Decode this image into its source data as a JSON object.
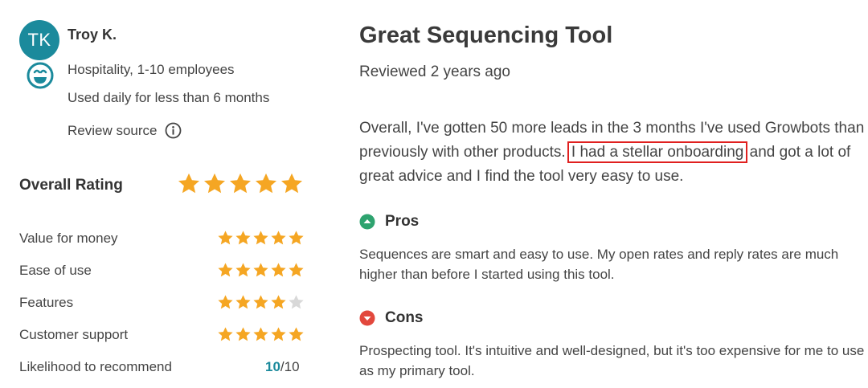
{
  "reviewer": {
    "initials": "TK",
    "name": "Troy K.",
    "industry": "Hospitality, 1-10 employees",
    "usage": "Used daily for less than 6 months",
    "source_label": "Review source"
  },
  "ratings": {
    "overall_label": "Overall Rating",
    "overall_stars": 5,
    "rows": [
      {
        "label": "Value for money",
        "stars": 5
      },
      {
        "label": "Ease of use",
        "stars": 5
      },
      {
        "label": "Features",
        "stars": 4
      },
      {
        "label": "Customer support",
        "stars": 5
      }
    ],
    "recommend_label": "Likelihood to recommend",
    "recommend_score": "10",
    "recommend_max": "/10"
  },
  "review": {
    "title": "Great Sequencing Tool",
    "reviewed": "Reviewed 2 years ago",
    "body_before": "Overall, I've gotten 50 more leads in the 3 months I've used Growbots than previously with other products.",
    "body_highlight": "I had a stellar onboarding",
    "body_after": "and got a lot of great advice and I find the tool very easy to use.",
    "pros_label": "Pros",
    "pros_text": "Sequences are smart and easy to use. My open rates and reply rates are much higher than before I started using this tool.",
    "cons_label": "Cons",
    "cons_text": "Prospecting tool. It's intuitive and well-designed, but it's too expensive for me to use as my primary tool."
  },
  "colors": {
    "star": "#f5a623",
    "star_empty": "#d8d8d8",
    "accent": "#1b8a9c",
    "pros": "#2ea36f",
    "cons": "#e2483d",
    "highlight_box": "#e0201f"
  }
}
